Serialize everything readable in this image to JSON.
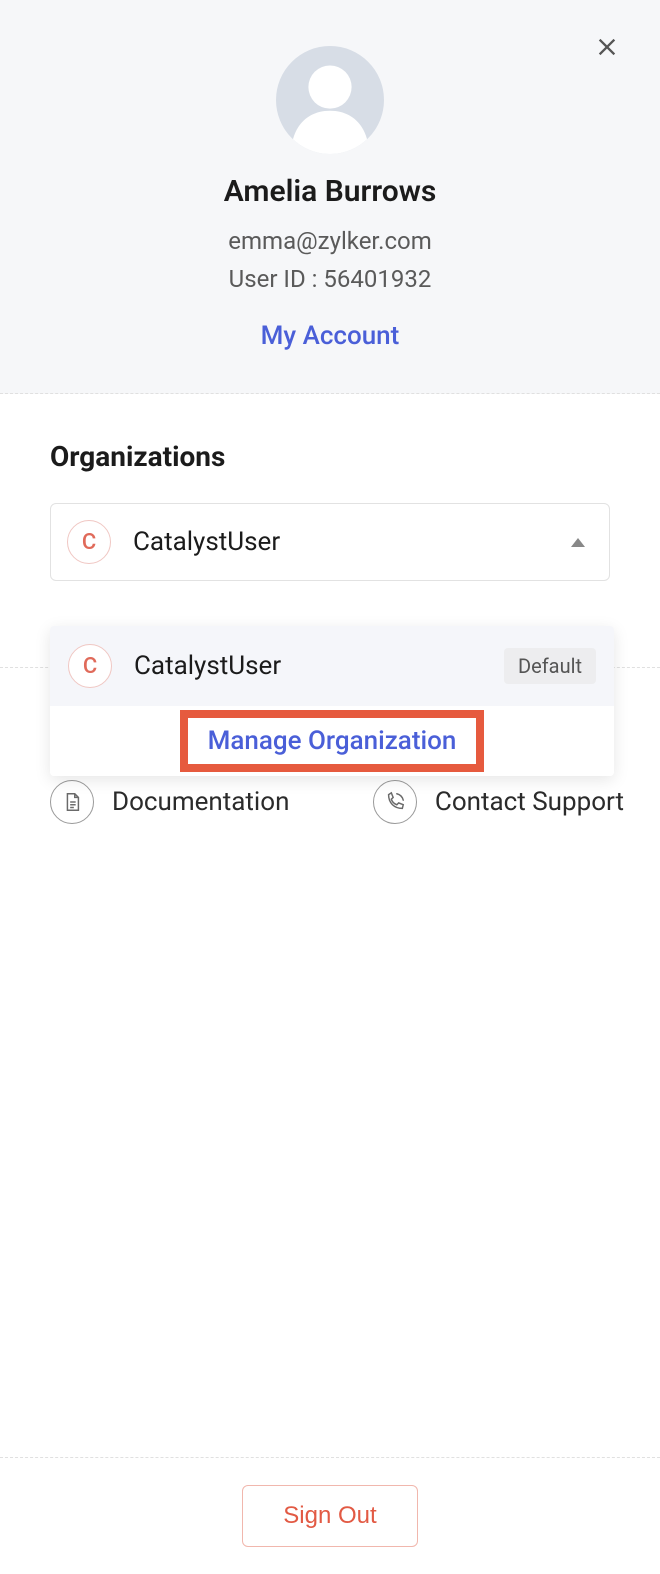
{
  "header": {
    "user_name": "Amelia Burrows",
    "user_email": "emma@zylker.com",
    "user_id_label": "User ID : 56401932",
    "my_account_label": "My Account"
  },
  "orgs": {
    "heading": "Organizations",
    "selected": {
      "initial": "C",
      "name": "CatalystUser"
    },
    "dropdown": {
      "item": {
        "initial": "C",
        "name": "CatalystUser",
        "default_label": "Default"
      },
      "manage_label": "Manage Organization"
    }
  },
  "quicklinks": {
    "documentation": "Documentation",
    "contact_support": "Contact Support"
  },
  "footer": {
    "signout_label": "Sign Out"
  }
}
